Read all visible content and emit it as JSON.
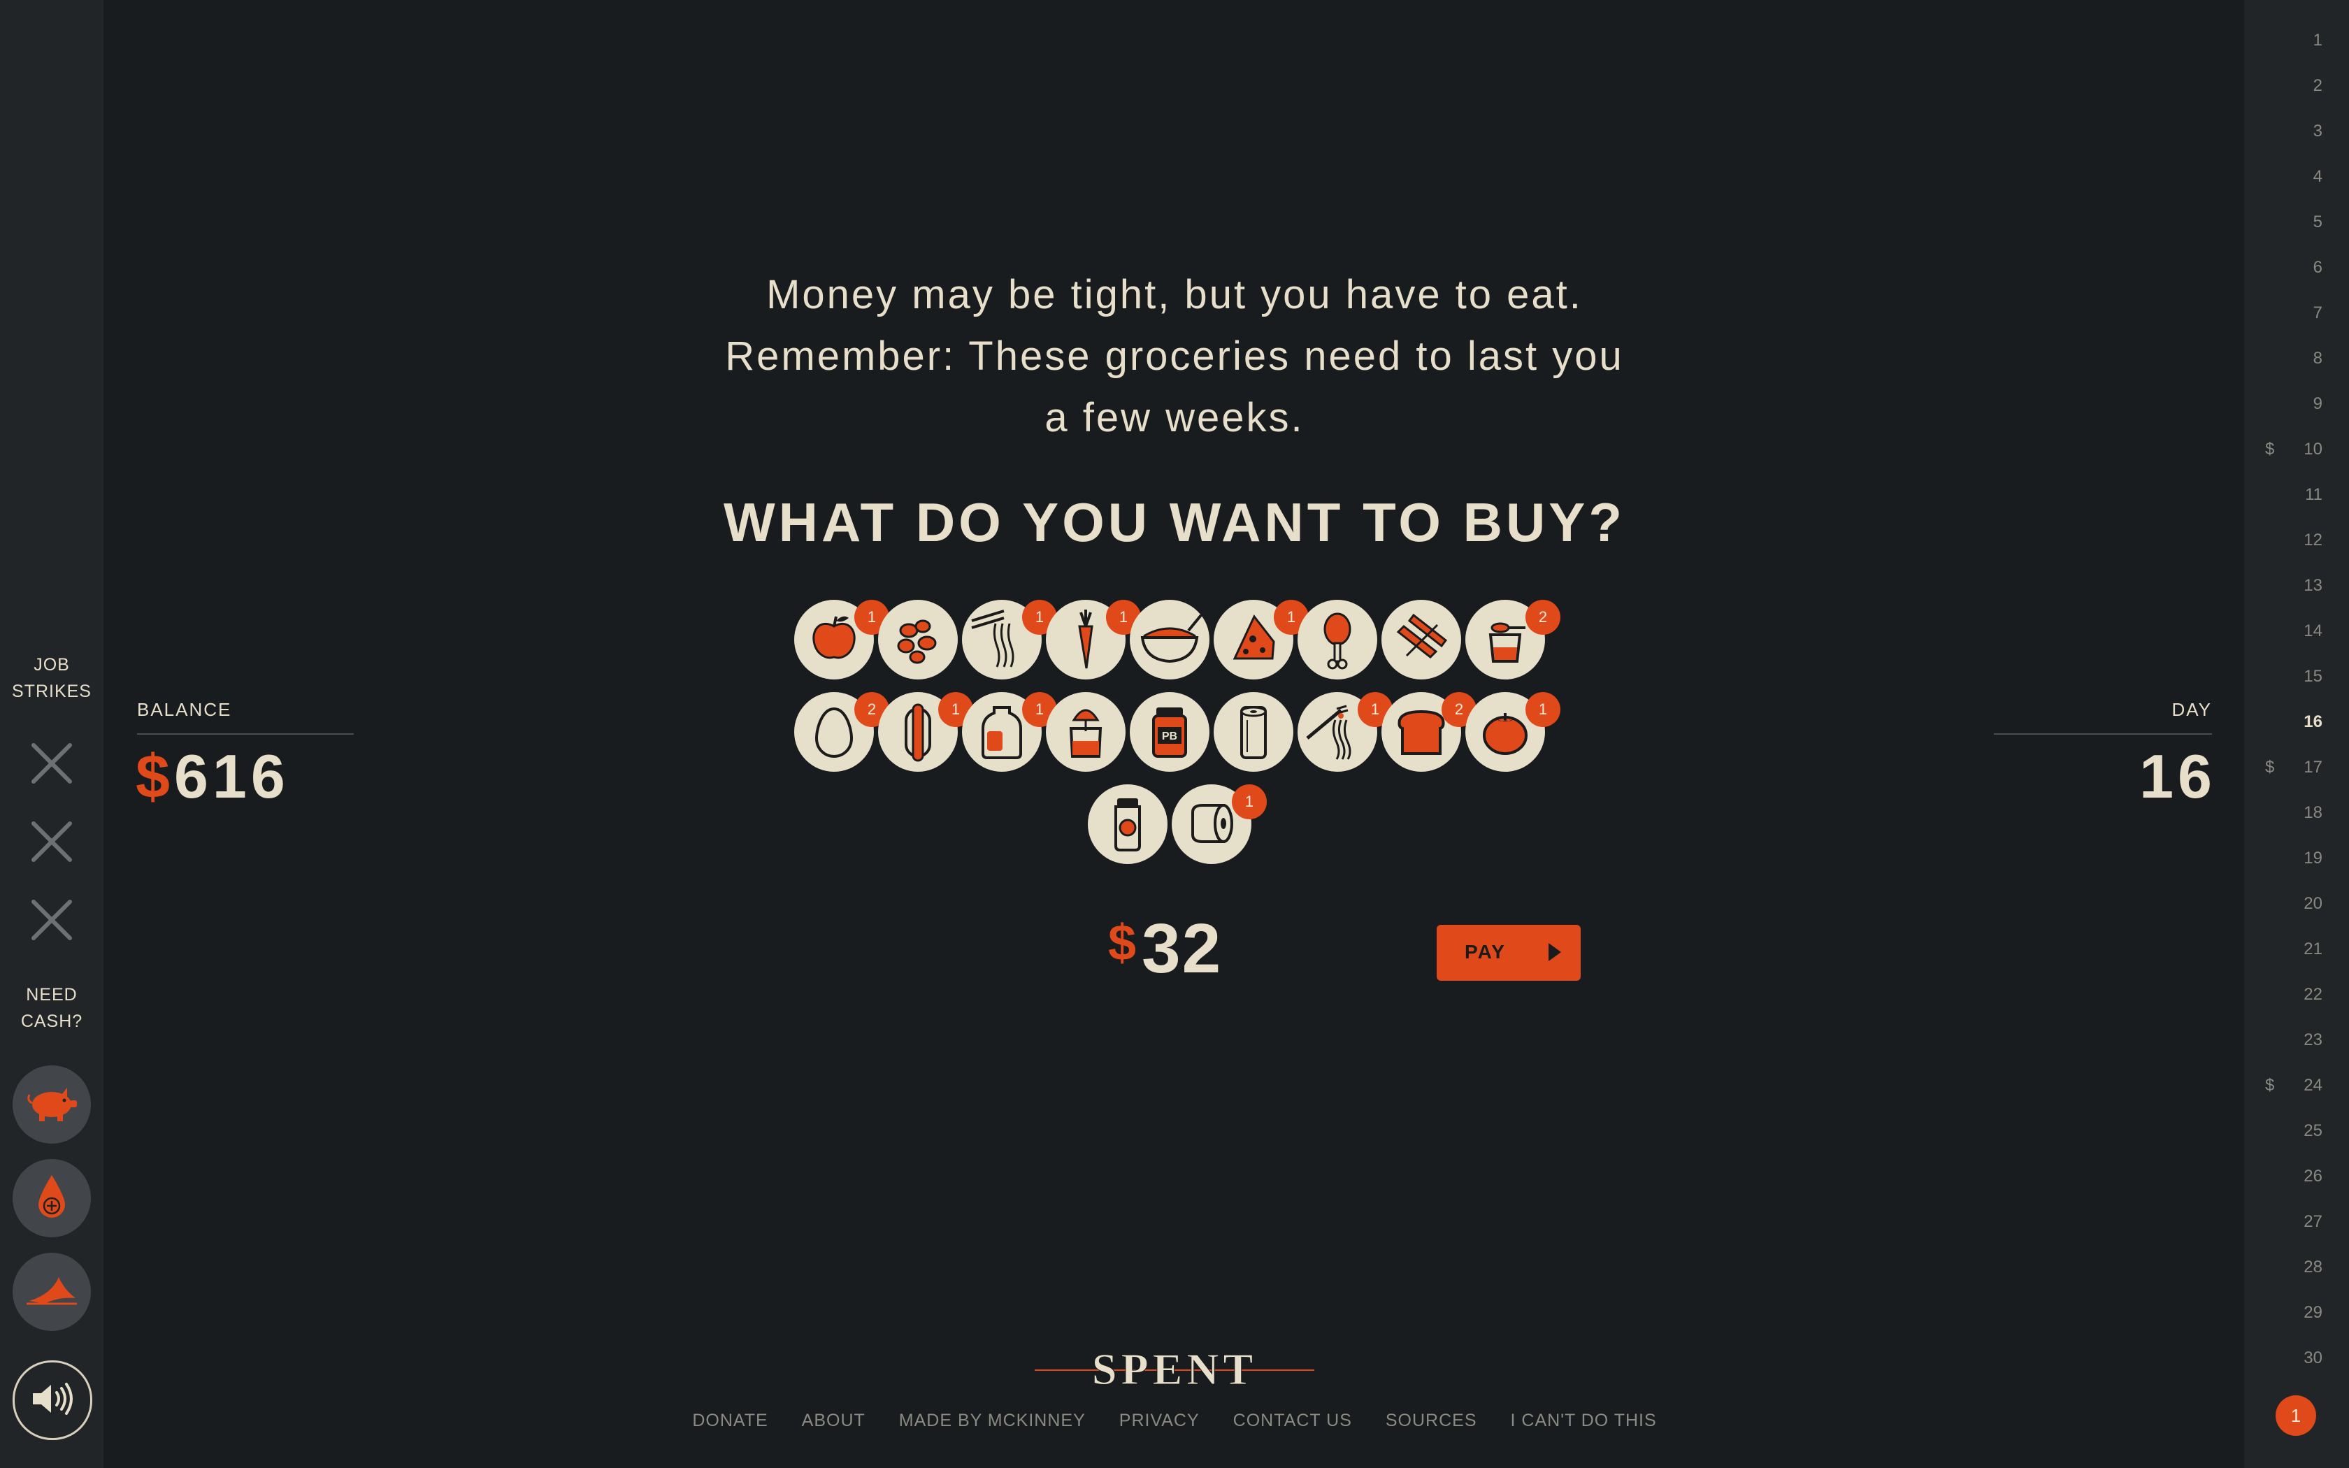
{
  "sidebar": {
    "strikes_label": [
      "JOB",
      "STRIKES"
    ],
    "cash_label": [
      "NEED",
      "CASH?"
    ],
    "strike_icons": [
      "close-icon",
      "close-icon",
      "close-icon"
    ],
    "cash_options": [
      {
        "name": "piggy-bank-icon"
      },
      {
        "name": "blood-drop-icon"
      },
      {
        "name": "shark-fin-icon"
      }
    ],
    "sound_icon": "speaker-icon"
  },
  "balance": {
    "label": "BALANCE",
    "currency": "$",
    "value": "616"
  },
  "day": {
    "label": "DAY",
    "value": "16"
  },
  "intro_lines": [
    "Money may be tight, but you have to eat.",
    "Remember: These groceries need to last you",
    "a few weeks."
  ],
  "question": "WHAT DO YOU WANT TO BUY?",
  "items": [
    {
      "name": "apple-icon",
      "count": "1"
    },
    {
      "name": "peanuts-icon",
      "count": ""
    },
    {
      "name": "ramen-noodles-icon",
      "count": "1"
    },
    {
      "name": "carrot-icon",
      "count": "1"
    },
    {
      "name": "cereal-bowl-icon",
      "count": ""
    },
    {
      "name": "cheese-icon",
      "count": "1"
    },
    {
      "name": "chicken-leg-icon",
      "count": ""
    },
    {
      "name": "bacon-icon",
      "count": ""
    },
    {
      "name": "baking-mix-icon",
      "count": "2"
    },
    {
      "name": "egg-icon",
      "count": "2"
    },
    {
      "name": "hot-dog-icon",
      "count": "1"
    },
    {
      "name": "milk-jug-icon",
      "count": "1"
    },
    {
      "name": "juice-carton-icon",
      "count": ""
    },
    {
      "name": "peanut-butter-jar-icon",
      "count": ""
    },
    {
      "name": "paper-towel-icon",
      "count": ""
    },
    {
      "name": "spaghetti-icon",
      "count": "1"
    },
    {
      "name": "bread-icon",
      "count": "2"
    },
    {
      "name": "tomato-icon",
      "count": "1"
    },
    {
      "name": "tomato-sauce-jar-icon",
      "count": ""
    },
    {
      "name": "toilet-paper-icon",
      "count": "1"
    }
  ],
  "total": {
    "currency": "$",
    "value": "32"
  },
  "pay_label": "PAY",
  "logo_text": "SPENT",
  "footer_links": [
    "DONATE",
    "ABOUT",
    "MADE BY MCKINNEY",
    "PRIVACY",
    "CONTACT US",
    "SOURCES",
    "I CAN'T DO THIS"
  ],
  "day_tracker": {
    "days": [
      "1",
      "2",
      "3",
      "4",
      "5",
      "6",
      "7",
      "8",
      "9",
      "10",
      "11",
      "12",
      "13",
      "14",
      "15",
      "16",
      "17",
      "18",
      "19",
      "20",
      "21",
      "22",
      "23",
      "24",
      "25",
      "26",
      "27",
      "28",
      "29",
      "30"
    ],
    "current": "16",
    "rent_days": [
      "10",
      "17",
      "24"
    ],
    "rent_marker": "$",
    "month": "1"
  },
  "colors": {
    "accent": "#e0491a",
    "background": "#191c1f",
    "rail": "#222528",
    "cream": "#e6dfc9"
  }
}
